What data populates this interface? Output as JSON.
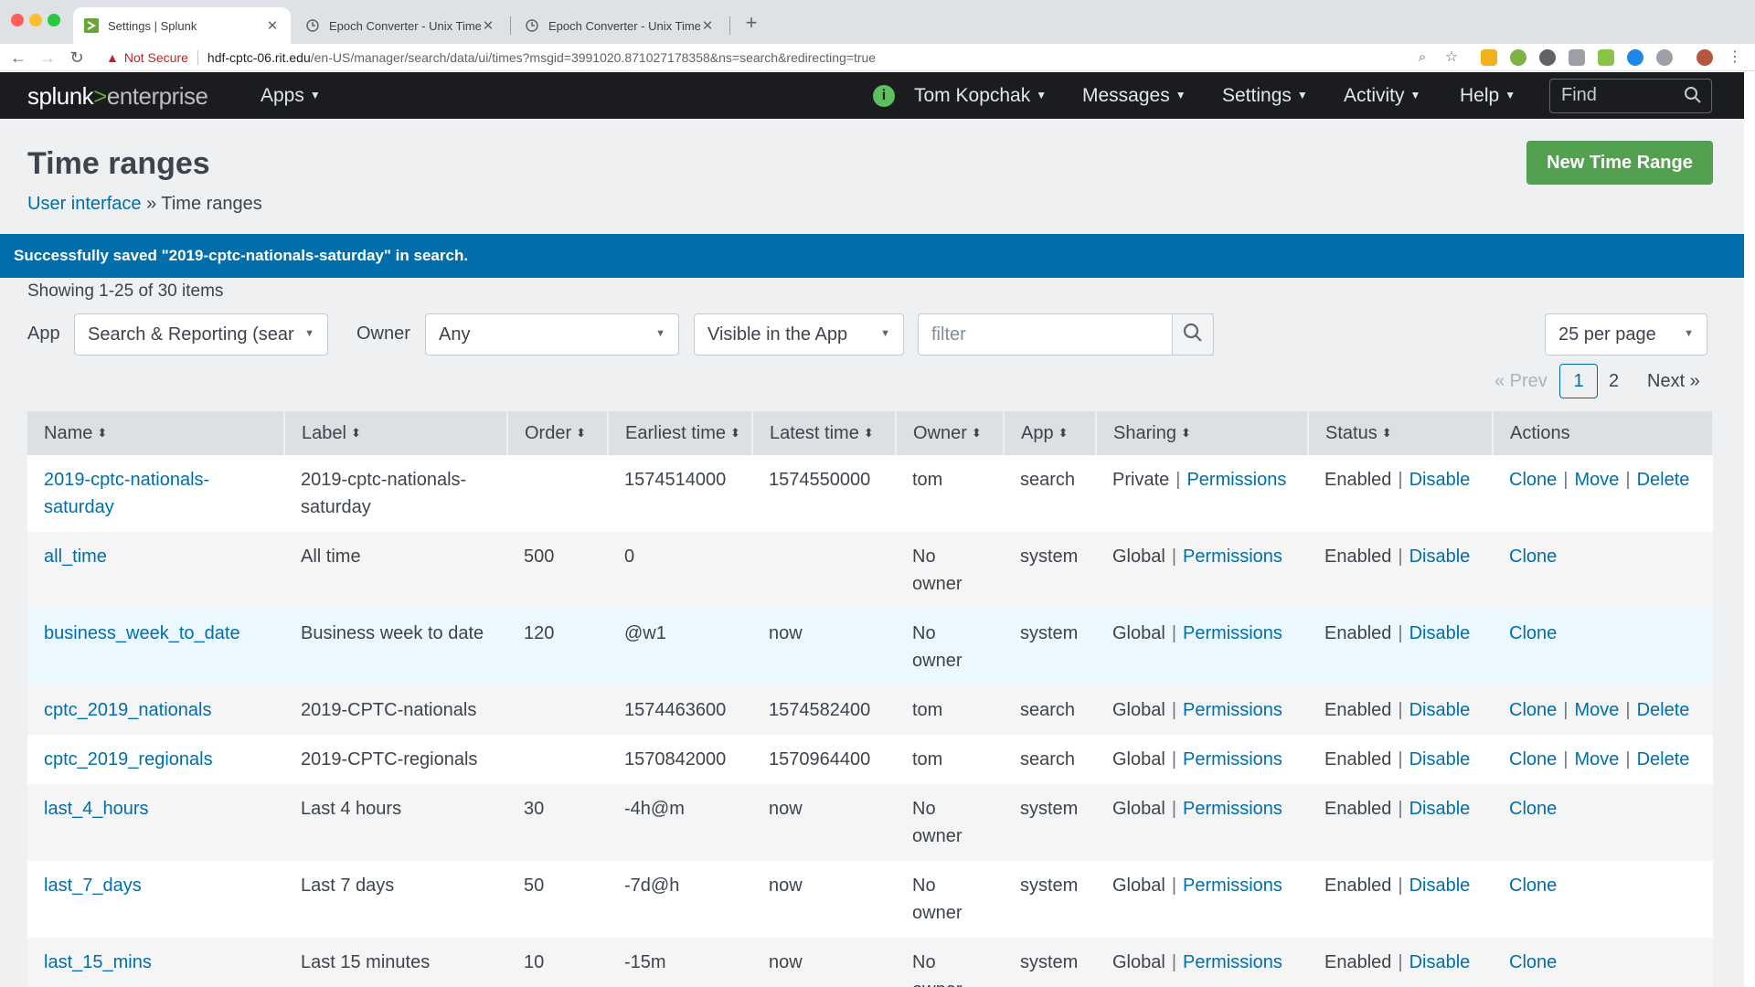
{
  "browser": {
    "tabs": [
      {
        "title": "Settings | Splunk",
        "active": true
      },
      {
        "title": "Epoch Converter - Unix Timest",
        "active": false
      },
      {
        "title": "Epoch Converter - Unix Timest",
        "active": false
      }
    ],
    "security_label": "Not Secure",
    "url_host": "hdf-cptc-06.rit.edu",
    "url_path": "/en-US/manager/search/data/ui/times?msgid=3991020.871027178358&ns=search&redirecting=true"
  },
  "nav": {
    "logo_splunk": "splunk",
    "logo_gt": ">",
    "logo_enterprise": "enterprise",
    "apps": "Apps",
    "user": "Tom Kopchak",
    "messages": "Messages",
    "settings": "Settings",
    "activity": "Activity",
    "help": "Help",
    "find_placeholder": "Find"
  },
  "page": {
    "title": "Time ranges",
    "breadcrumb_parent": "User interface",
    "breadcrumb_sep": "»",
    "breadcrumb_current": "Time ranges",
    "new_button": "New Time Range",
    "banner": "Successfully saved \"2019-cptc-nationals-saturday\" in search.",
    "showing": "Showing 1-25 of 30 items"
  },
  "filters": {
    "app_label": "App",
    "app_value": "Search & Reporting (sear",
    "owner_label": "Owner",
    "owner_value": "Any",
    "visibility_value": "Visible in the App",
    "filter_placeholder": "filter",
    "per_page": "25 per page"
  },
  "pagination": {
    "prev": "« Prev",
    "current": "1",
    "page2": "2",
    "next": "Next »"
  },
  "table": {
    "headers": [
      "Name",
      "Label",
      "Order",
      "Earliest time",
      "Latest time",
      "Owner",
      "App",
      "Sharing",
      "Status",
      "Actions"
    ],
    "permissions_label": "Permissions",
    "disable_label": "Disable",
    "rows": [
      {
        "name": "2019-cptc-nationals-saturday",
        "label": "2019-cptc-nationals-saturday",
        "order": "",
        "earliest": "1574514000",
        "latest": "1574550000",
        "owner": "tom",
        "app": "search",
        "sharing": "Private",
        "status": "Enabled",
        "actions": [
          "Clone",
          "Move",
          "Delete"
        ]
      },
      {
        "name": "all_time",
        "label": "All time",
        "order": "500",
        "earliest": "0",
        "latest": "",
        "owner": "No owner",
        "app": "system",
        "sharing": "Global",
        "status": "Enabled",
        "actions": [
          "Clone"
        ]
      },
      {
        "name": "business_week_to_date",
        "label": "Business week to date",
        "order": "120",
        "earliest": "@w1",
        "latest": "now",
        "owner": "No owner",
        "app": "system",
        "sharing": "Global",
        "status": "Enabled",
        "actions": [
          "Clone"
        ]
      },
      {
        "name": "cptc_2019_nationals",
        "label": "2019-CPTC-nationals",
        "order": "",
        "earliest": "1574463600",
        "latest": "1574582400",
        "owner": "tom",
        "app": "search",
        "sharing": "Global",
        "status": "Enabled",
        "actions": [
          "Clone",
          "Move",
          "Delete"
        ]
      },
      {
        "name": "cptc_2019_regionals",
        "label": "2019-CPTC-regionals",
        "order": "",
        "earliest": "1570842000",
        "latest": "1570964400",
        "owner": "tom",
        "app": "search",
        "sharing": "Global",
        "status": "Enabled",
        "actions": [
          "Clone",
          "Move",
          "Delete"
        ]
      },
      {
        "name": "last_4_hours",
        "label": "Last 4 hours",
        "order": "30",
        "earliest": "-4h@m",
        "latest": "now",
        "owner": "No owner",
        "app": "system",
        "sharing": "Global",
        "status": "Enabled",
        "actions": [
          "Clone"
        ]
      },
      {
        "name": "last_7_days",
        "label": "Last 7 days",
        "order": "50",
        "earliest": "-7d@h",
        "latest": "now",
        "owner": "No owner",
        "app": "system",
        "sharing": "Global",
        "status": "Enabled",
        "actions": [
          "Clone"
        ]
      },
      {
        "name": "last_15_mins",
        "label": "Last 15 minutes",
        "order": "10",
        "earliest": "-15m",
        "latest": "now",
        "owner": "No owner",
        "app": "system",
        "sharing": "Global",
        "status": "Enabled",
        "actions": [
          "Clone"
        ]
      }
    ]
  },
  "colors": {
    "link": "#006eaa",
    "primary_button": "#53a051",
    "banner": "#006eaa",
    "nav_bg": "#1a1c20"
  }
}
